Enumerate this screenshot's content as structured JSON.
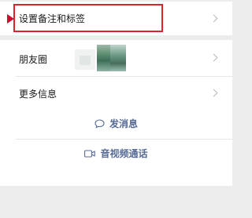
{
  "rows": {
    "remark_label": "设置备注和标签",
    "moments_label": "朋友圈",
    "more_info_label": "更多信息"
  },
  "actions": {
    "send_message_label": "发消息",
    "av_call_label": "音视频通话"
  },
  "icons": {
    "message": "chat-bubble-icon",
    "call": "video-camera-icon",
    "chevron": "chevron-right-icon",
    "pointer": "red-arrow-pointer"
  },
  "colors": {
    "highlight": "#e0202a",
    "link": "#576b95",
    "background": "#ededed"
  }
}
